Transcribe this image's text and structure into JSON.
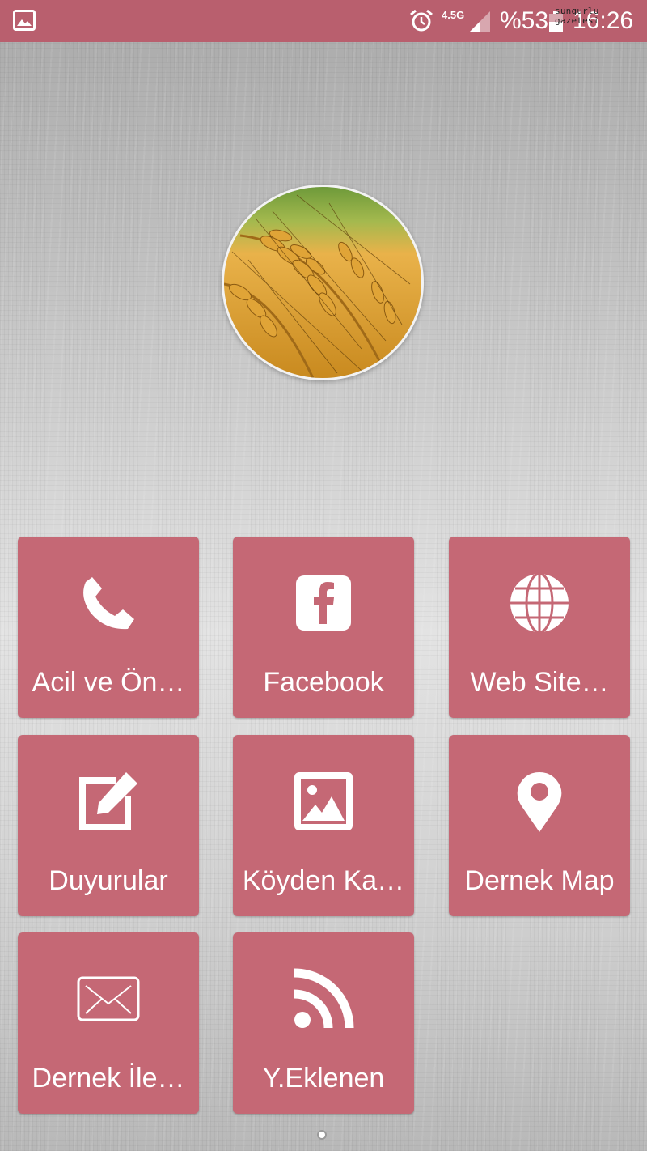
{
  "status_bar": {
    "network": "4.5G",
    "battery": "%53",
    "time": "16:26",
    "watermark": "sungurlu gazetesi",
    "icons": [
      "gallery-icon",
      "alarm-icon",
      "signal-icon",
      "battery-icon"
    ]
  },
  "logo": {
    "icon": "wheat-logo"
  },
  "tiles": [
    {
      "label": "Acil ve Ön…",
      "icon": "phone-icon"
    },
    {
      "label": "Facebook",
      "icon": "facebook-icon"
    },
    {
      "label": "Web Site…",
      "icon": "globe-icon"
    },
    {
      "label": "Duyurular",
      "icon": "edit-icon"
    },
    {
      "label": "Köyden Ka…",
      "icon": "image-icon"
    },
    {
      "label": "Dernek Map",
      "icon": "map-pin-icon"
    },
    {
      "label": "Dernek İle…",
      "icon": "mail-icon"
    },
    {
      "label": "Y.Eklenen",
      "icon": "rss-icon"
    }
  ],
  "colors": {
    "tile": "#c56875",
    "status_bar": "#b95f6e"
  },
  "pager": {
    "pages": 1,
    "current": 1
  }
}
